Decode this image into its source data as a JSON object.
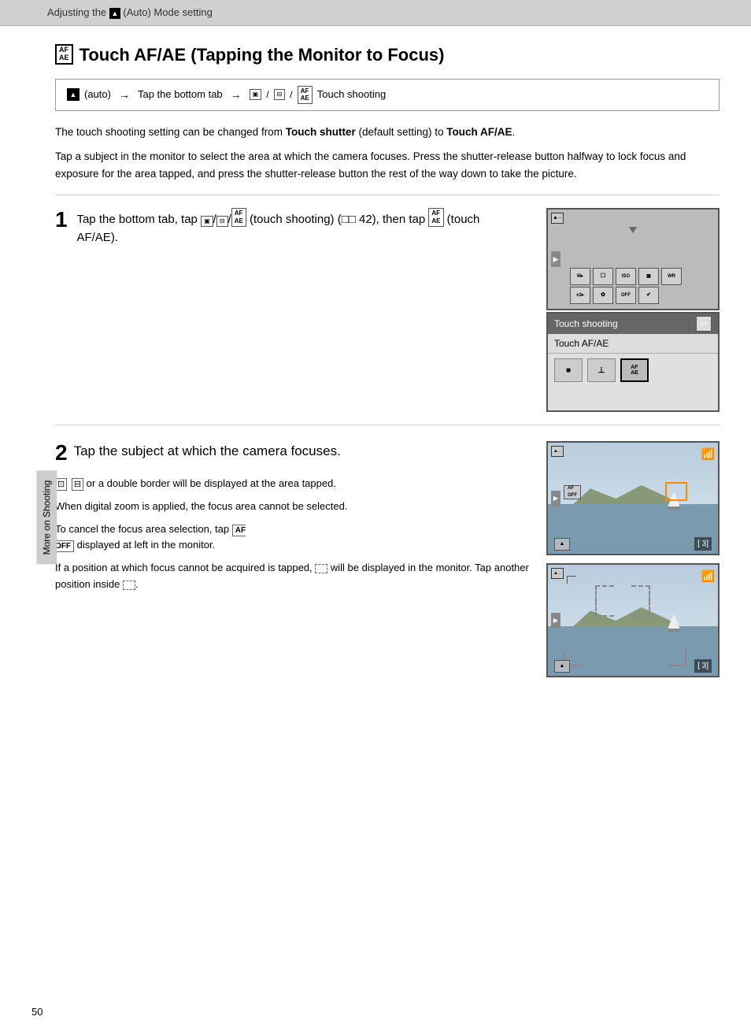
{
  "header": {
    "text": "Adjusting the  (Auto) Mode setting",
    "camera_symbol": "▲"
  },
  "side_tab": {
    "label": "More on Shooting"
  },
  "page": {
    "title": "Touch AF/AE (Tapping the Monitor to Focus)",
    "title_icon_text": "AF\nAE",
    "nav_box": {
      "auto_label": "(auto)",
      "arrow": "→",
      "step1": "Tap the bottom tab",
      "arrow2": "→",
      "icons_label": "Touch shooting"
    },
    "description1": "The touch shooting setting can be changed from Touch shutter (default setting) to Touch AF/AE.",
    "description1_bold1": "Touch shutter",
    "description1_bold2": "Touch AF/AE",
    "description2": "Tap a subject in the monitor to select the area at which the camera focuses. Press the shutter-release button halfway to lock focus and exposure for the area tapped, and press the shutter-release button the rest of the way down to take the picture.",
    "step1": {
      "number": "1",
      "text": "Tap the bottom tab, tap  / /  (touch shooting) (  42), then tap  (touch AF/AE).",
      "text_plain": "Tap the bottom tab, tap (touch shooting) (□42), then tap (touch AF/AE).",
      "menu_title": "Touch shooting",
      "menu_subtitle": "Touch AF/AE",
      "menu_icons": [
        "▣",
        "⊟",
        "AF\nAE"
      ],
      "back_label": "↩"
    },
    "step2": {
      "number": "2",
      "text": "Tap the subject at which the camera focuses.",
      "sub1": "or a double border will be displayed at the area tapped.",
      "sub2": "When digital zoom is applied, the focus area cannot be selected.",
      "sub3": "To cancel the focus area selection, tap  displayed at left in the monitor.",
      "sub4": "If a position at which focus cannot be acquired is tapped,  will be displayed in the monitor. Tap another position inside .",
      "frame_counter": "[ 3]"
    },
    "page_number": "50"
  },
  "colors": {
    "header_bg": "#d0d0d0",
    "nav_border": "#999",
    "separator": "#ccc",
    "cam_bg": "#bbbbbb",
    "focus_bracket": "#ff8800",
    "menu_title_bg": "#666666",
    "menu_title_text": "#ffffff"
  }
}
